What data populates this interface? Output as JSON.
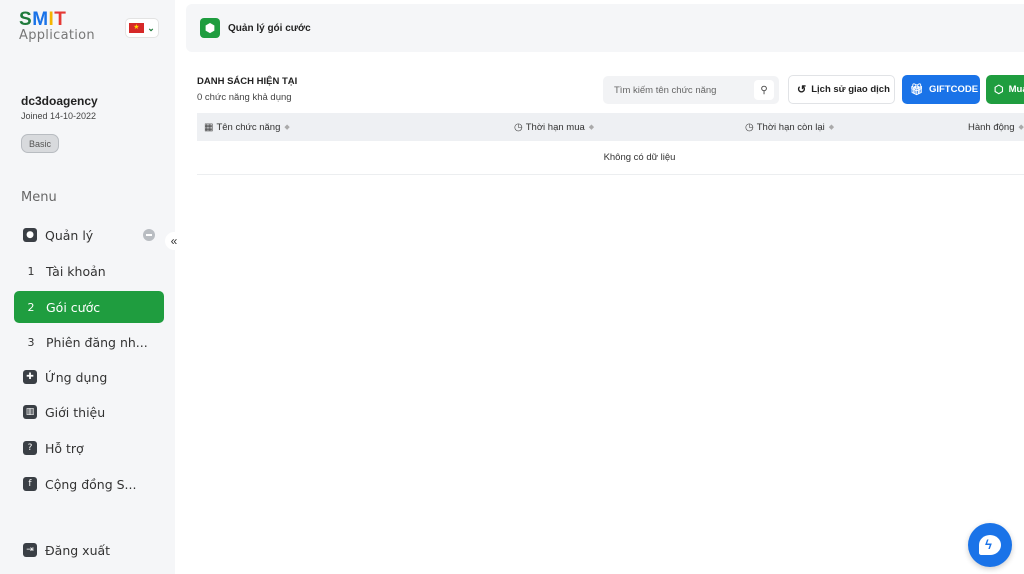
{
  "brand": {
    "logo_smit": "SMIT",
    "logo_app": "Application"
  },
  "language": {
    "selected": "vi",
    "flag_color": "#d62828"
  },
  "user": {
    "name": "dc3doagency",
    "joined": "Joined 14-10-2022",
    "plan_badge": "Basic"
  },
  "sidebar": {
    "menu_title": "Menu",
    "items": [
      {
        "label": "Quản lý",
        "icon": "user-icon",
        "expanded": true
      },
      {
        "num": "1",
        "label": "Tài khoản"
      },
      {
        "num": "2",
        "label": "Gói cước",
        "active": true
      },
      {
        "num": "3",
        "label": "Phiên đăng nh..."
      },
      {
        "label": "Ứng dụng",
        "icon": "puzzle-icon"
      },
      {
        "label": "Giới thiệu",
        "icon": "gift-icon"
      },
      {
        "label": "Hỗ trợ",
        "icon": "help-icon"
      },
      {
        "label": "Cộng đồng S...",
        "icon": "facebook-icon"
      }
    ],
    "logout_label": "Đăng xuất",
    "collapse_glyph": "«"
  },
  "header": {
    "title": "Quản lý gói cước",
    "accent": "#1f9d3f"
  },
  "list": {
    "title": "DANH SÁCH HIỆN TẠI",
    "subtitle": "0 chức năng khả dụng"
  },
  "search": {
    "placeholder": "Tìm kiếm tên chức năng"
  },
  "actions": {
    "history_label": "Lịch sử giao dịch",
    "giftcode_label": "GIFTCODE",
    "buy_label": "Mua"
  },
  "table": {
    "columns": [
      "Tên chức năng",
      "Thời hạn mua",
      "Thời hạn còn lại",
      "Hành động"
    ],
    "empty_text": "Không có dữ liệu"
  },
  "colors": {
    "primary_blue": "#1a73e8",
    "primary_green": "#1f9d3f"
  }
}
